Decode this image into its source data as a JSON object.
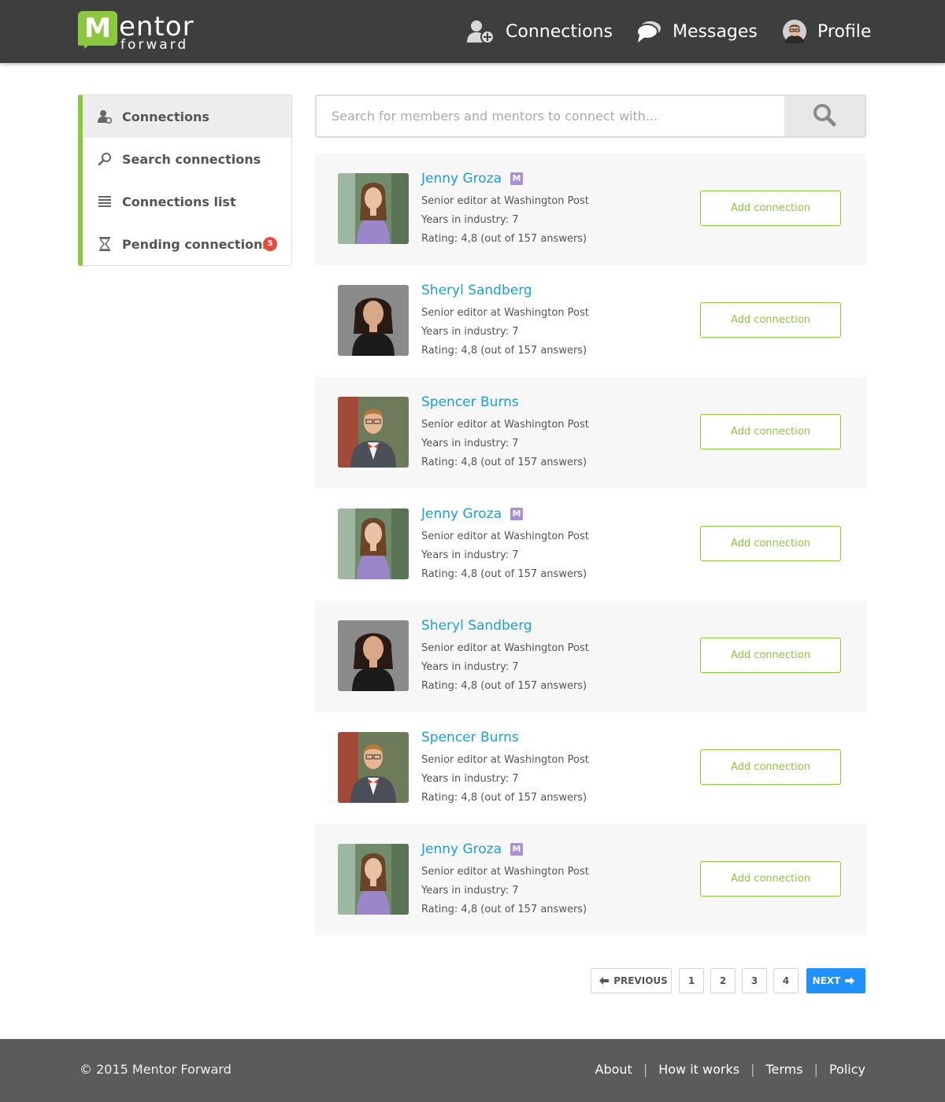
{
  "brand": {
    "logo_letter": "M",
    "logo_word": "entor",
    "logo_sub": "forward",
    "accent": "#8dc63f"
  },
  "nav": {
    "connections": "Connections",
    "messages": "Messages",
    "profile": "Profile"
  },
  "sidebar": {
    "items": [
      {
        "label": "Connections",
        "icon": "user-gear-icon"
      },
      {
        "label": "Search connections",
        "icon": "search-icon"
      },
      {
        "label": "Connections list",
        "icon": "list-icon"
      },
      {
        "label": "Pending connections",
        "icon": "hourglass-icon",
        "badge": "5"
      }
    ]
  },
  "search": {
    "placeholder": "Search for members and mentors to connect with..."
  },
  "members": [
    {
      "name": "Jenny Groza",
      "mentor": "M",
      "title": "Senior editor at Washington Post",
      "years": "Years in industry: 7",
      "rating": "Rating:  4,8 (out of 157 answers)",
      "button": "Add connection"
    },
    {
      "name": "Sheryl Sandberg",
      "title": "Senior editor at Washington Post",
      "years": "Years in industry: 7",
      "rating": "Rating:  4,8 (out of 157 answers)",
      "button": "Add connection"
    },
    {
      "name": "Spencer Burns",
      "title": "Senior editor at Washington Post",
      "years": "Years in industry: 7",
      "rating": "Rating:  4,8 (out of 157 answers)",
      "button": "Add connection"
    },
    {
      "name": "Jenny Groza",
      "mentor": "M",
      "title": "Senior editor at Washington Post",
      "years": "Years in industry: 7",
      "rating": "Rating:  4,8 (out of 157 answers)",
      "button": "Add connection"
    },
    {
      "name": "Sheryl Sandberg",
      "title": "Senior editor at Washington Post",
      "years": "Years in industry: 7",
      "rating": "Rating:  4,8 (out of 157 answers)",
      "button": "Add connection"
    },
    {
      "name": "Spencer Burns",
      "title": "Senior editor at Washington Post",
      "years": "Years in industry: 7",
      "rating": "Rating:  4,8 (out of 157 answers)",
      "button": "Add connection"
    },
    {
      "name": "Jenny Groza",
      "mentor": "M",
      "title": "Senior editor at Washington Post",
      "years": "Years in industry: 7",
      "rating": "Rating:  4,8 (out of 157 answers)",
      "button": "Add connection"
    }
  ],
  "pagination": {
    "previous": "PREVIOUS",
    "pages": [
      "1",
      "2",
      "3",
      "4"
    ],
    "next": "NEXT",
    "accent": "#1e90ff"
  },
  "footer": {
    "copyright": "© 2015 Mentor Forward",
    "links": [
      "About",
      "How it works",
      "Terms",
      "Policy"
    ]
  }
}
